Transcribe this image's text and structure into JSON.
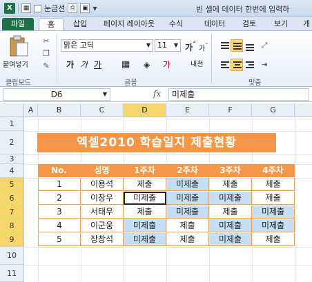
{
  "qat": {
    "checkbox_label": "눈금선"
  },
  "window_title": "빈 셀에 데이터 한번에 입력하",
  "tabs": [
    "파일",
    "홈",
    "삽입",
    "페이지 레이아웃",
    "수식",
    "데이터",
    "검토",
    "보기",
    "개"
  ],
  "ribbon": {
    "paste_label": "붙여넣기",
    "clipboard_label": "클립보드",
    "font_group_label": "글꼴",
    "align_group_label": "맞춤",
    "font_name": "맑은 고딕",
    "font_size": "11",
    "bold": "가",
    "italic": "가",
    "underline": "가",
    "grow_font": "가",
    "shrink_font": "가",
    "phonetic": "내천",
    "font_color_glyph": "가"
  },
  "formula_bar": {
    "name_box": "D6",
    "fx": "fx",
    "formula": "미제출"
  },
  "columns": [
    "A",
    "B",
    "C",
    "D",
    "E",
    "F",
    "G"
  ],
  "selected_column": "D",
  "rows": [
    "1",
    "2",
    "3",
    "4",
    "5",
    "6",
    "7",
    "8",
    "9",
    "10",
    "11"
  ],
  "selected_rows": [
    "5",
    "6",
    "7",
    "8",
    "9"
  ],
  "sheet": {
    "title": "엑셀2010 학습일지 제출현황",
    "headers": [
      "No.",
      "성명",
      "1주차",
      "2주차",
      "3주차",
      "4주차"
    ],
    "records": [
      {
        "no": "1",
        "name": "이용석",
        "w1": "제출",
        "w2": "미제출",
        "w3": "제출",
        "w4": "제출"
      },
      {
        "no": "2",
        "name": "이창우",
        "w1": "미제출",
        "w2": "미제출",
        "w3": "미제출",
        "w4": "제출"
      },
      {
        "no": "3",
        "name": "서태우",
        "w1": "제출",
        "w2": "미제출",
        "w3": "제출",
        "w4": "미제출"
      },
      {
        "no": "4",
        "name": "이군웅",
        "w1": "미제출",
        "w2": "제출",
        "w3": "미제출",
        "w4": "미제출"
      },
      {
        "no": "5",
        "name": "장창석",
        "w1": "미제출",
        "w2": "제출",
        "w3": "미제출",
        "w4": "제출"
      }
    ]
  },
  "colors": {
    "accent_orange": "#f79646",
    "selected_blue": "#c6dff4",
    "excel_green": "#1e7145"
  }
}
